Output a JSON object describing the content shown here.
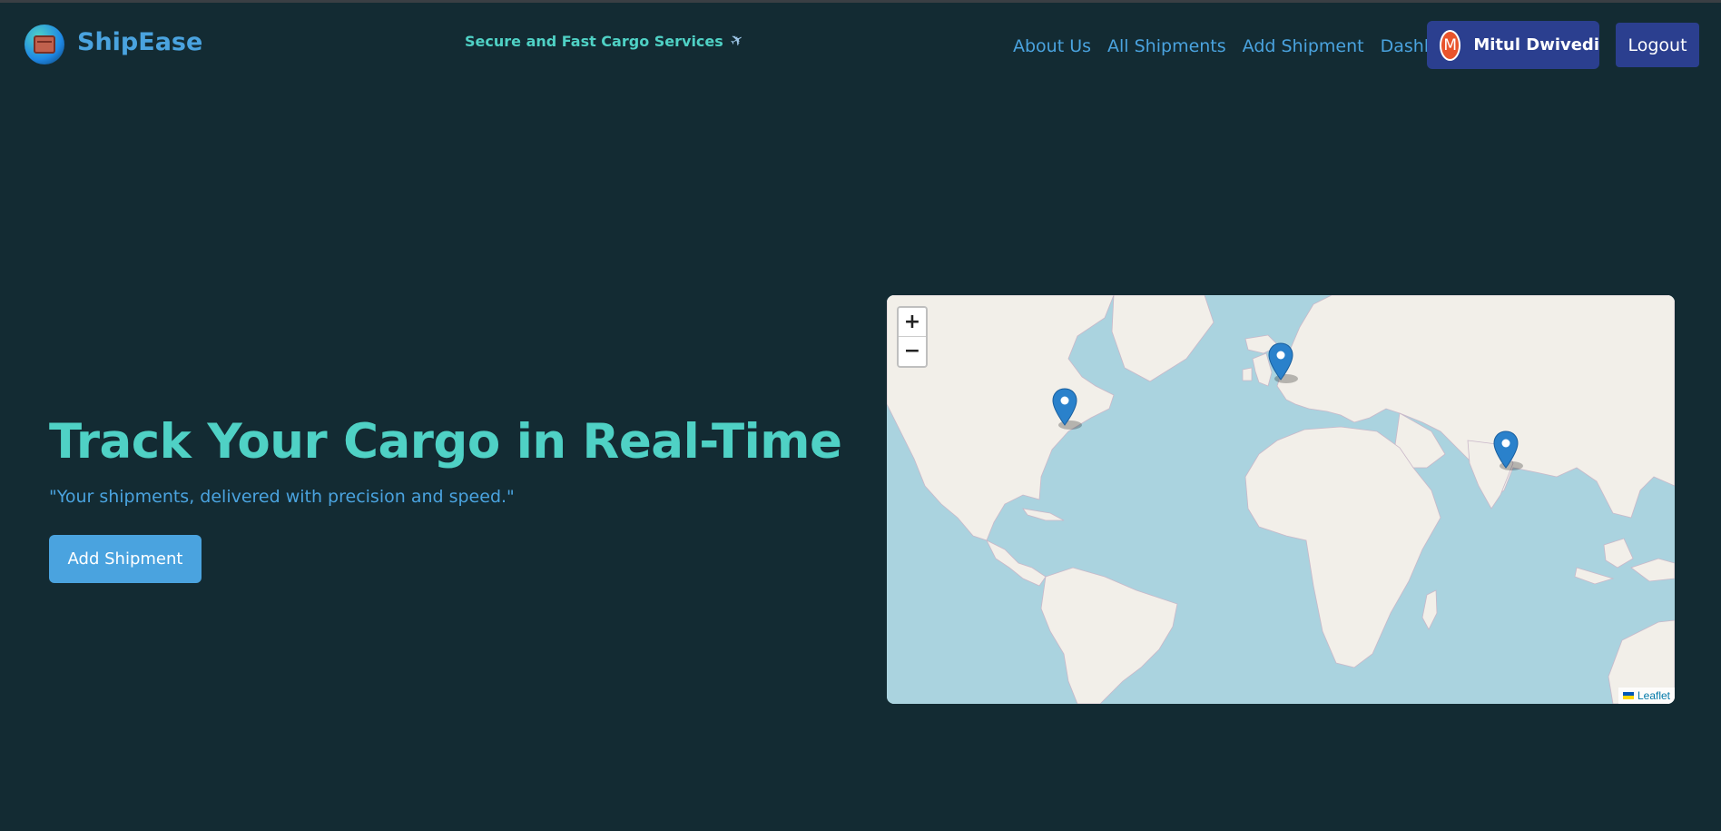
{
  "navbar": {
    "brand": "ShipEase",
    "tagline": "Secure and Fast Cargo Services",
    "links": [
      {
        "label": "About Us"
      },
      {
        "label": "All Shipments"
      },
      {
        "label": "Add Shipment"
      },
      {
        "label": "Dashboard"
      }
    ],
    "user": {
      "initial": "M",
      "name": "Mitul Dwivedi"
    },
    "logout_label": "Logout"
  },
  "hero": {
    "title": "Track Your Cargo in Real-Time",
    "subtitle": "\"Your shipments, delivered with precision and speed.\"",
    "button_label": "Add Shipment"
  },
  "map": {
    "zoom_in_label": "+",
    "zoom_out_label": "−",
    "attribution": "Leaflet"
  },
  "colors": {
    "background": "#132b33",
    "accent_teal": "#4fd1c5",
    "accent_blue": "#4aa3df",
    "button_navy": "#2b3f8f",
    "avatar": "#e8542b"
  }
}
